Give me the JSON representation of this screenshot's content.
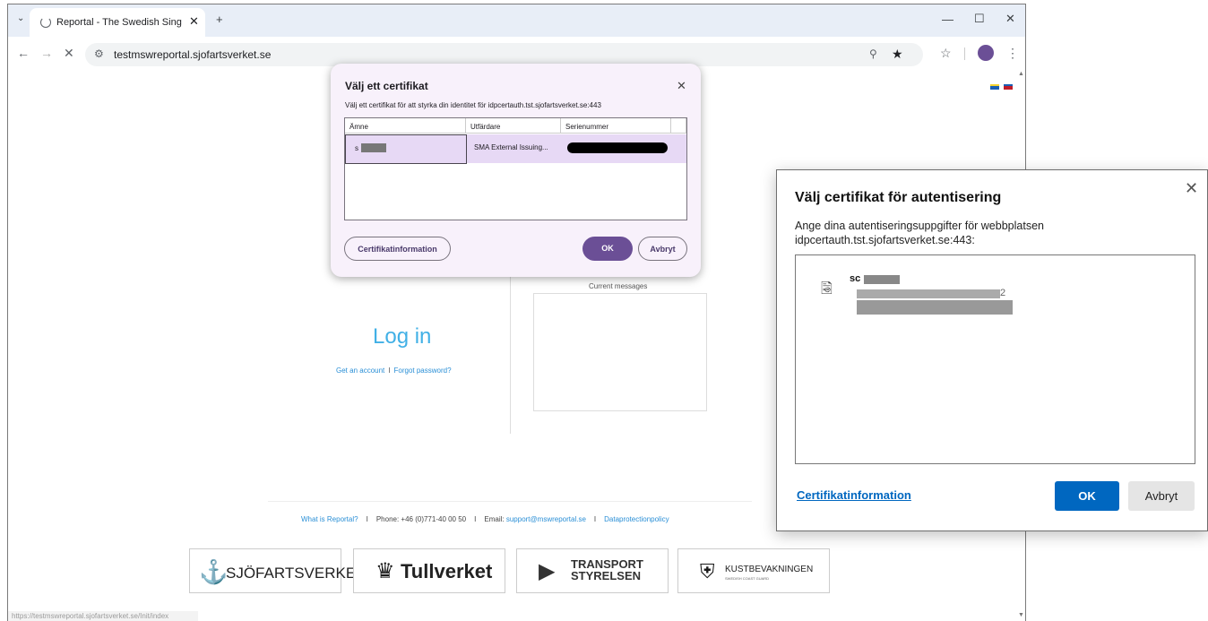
{
  "browser": {
    "tab_title": "Reportal - The Swedish Single W",
    "new_tab": "+",
    "url": "testmswreportal.sjofartsverket.se",
    "status_url": "https://testmswreportal.sjofartsverket.se/Init/index"
  },
  "page": {
    "login_title": "Log in",
    "get_account": "Get an account",
    "link_sep": "I",
    "forgot_password": "Forgot password?",
    "current_messages": "Current messages",
    "footer": {
      "what_is": "What is Reportal?",
      "sep": "I",
      "phone": "Phone: +46 (0)771-40 00 50",
      "email_label": "Email:",
      "email": "support@mswreportal.se",
      "dataprotection": "Dataprotectionpolicy"
    },
    "logos": {
      "sjofartsverket": "SJÖFARTSVERKET",
      "tullverket": "Tullverket",
      "transport_line1": "TRANSPORT",
      "transport_line2": "STYRELSEN",
      "kustbevakningen": "KUSTBEVAKNINGEN",
      "kustbevakningen_sub": "SWEDISH COAST GUARD"
    }
  },
  "chrome_dialog": {
    "title": "Välj ett certifikat",
    "subtitle": "Välj ett certifikat för att styrka din identitet för idpcertauth.tst.sjofartsverket.se:443",
    "columns": [
      "Ämne",
      "Utfärdare",
      "Serienummer"
    ],
    "row": {
      "subject": "s",
      "issuer": "SMA External Issuing..."
    },
    "info_button": "Certifikatinformation",
    "ok_button": "OK",
    "cancel_button": "Avbryt"
  },
  "win_dialog": {
    "title": "Välj certifikat för autentisering",
    "description": "Ange dina autentiseringsuppgifter för webbplatsen idpcertauth.tst.sjofartsverket.se:443:",
    "cert_name": "sc",
    "cert_issuer_tail": "2",
    "info_link": "Certifikatinformation",
    "ok_button": "OK",
    "cancel_button": "Avbryt"
  },
  "colors": {
    "accent_purple": "#6b4f96",
    "login_blue": "#41b0e6",
    "windows_blue": "#0067c0"
  }
}
